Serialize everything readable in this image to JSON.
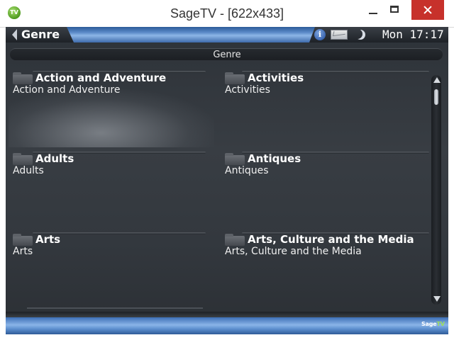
{
  "window": {
    "icon_label": "TV",
    "title": "SageTV - [622x433]"
  },
  "topbar": {
    "back_label": "Genre",
    "status_icons": [
      "info-icon",
      "mail-icon",
      "moon-icon"
    ],
    "clock": "Mon 17:17"
  },
  "header": {
    "title": "Genre"
  },
  "genres": [
    {
      "title": "Action and Adventure",
      "subtitle": "Action and Adventure",
      "focused": true
    },
    {
      "title": "Activities",
      "subtitle": "Activities"
    },
    {
      "title": "Adults",
      "subtitle": "Adults"
    },
    {
      "title": "Antiques",
      "subtitle": "Antiques"
    },
    {
      "title": "Arts",
      "subtitle": "Arts"
    },
    {
      "title": "Arts, Culture and the Media",
      "subtitle": "Arts, Culture and the Media"
    }
  ],
  "footer": {
    "logo_text": "Sage",
    "logo_accent": "TV"
  },
  "colors": {
    "close_button": "#c7312b",
    "sky_blue": "#5a89c8",
    "panel_dark": "#33383e"
  }
}
